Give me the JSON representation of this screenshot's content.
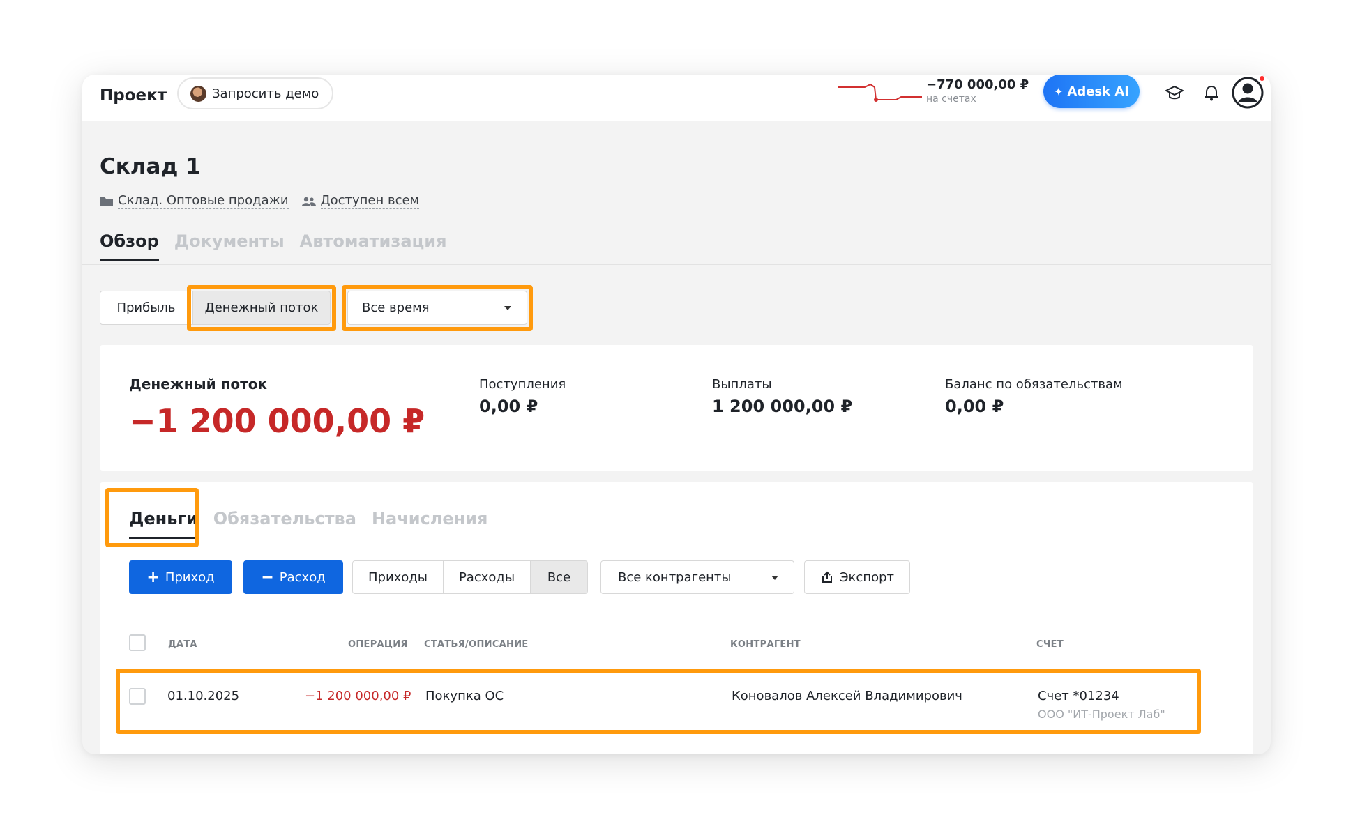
{
  "topbar": {
    "brand": "Проект",
    "demo_button": "Запросить демо",
    "balance_amount": "−770 000,00 ₽",
    "balance_caption": "на счетах",
    "ai_button": "Adesk AI"
  },
  "page": {
    "title": "Склад 1",
    "folder": "Склад. Оптовые продажи",
    "access": "Доступен всем",
    "tabs": [
      {
        "label": "Обзор",
        "active": true
      },
      {
        "label": "Документы",
        "active": false
      },
      {
        "label": "Автоматизация",
        "active": false
      }
    ]
  },
  "controls": {
    "mode_profit": "Прибыль",
    "mode_cashflow": "Денежный поток",
    "period": "Все время"
  },
  "summary": {
    "cashflow_label": "Денежный поток",
    "cashflow_value": "−1 200 000,00 ₽",
    "income_label": "Поступления",
    "income_value": "0,00 ₽",
    "payments_label": "Выплаты",
    "payments_value": "1 200 000,00 ₽",
    "liabilities_label": "Баланс по обязательствам",
    "liabilities_value": "0,00 ₽"
  },
  "money": {
    "tabs": [
      {
        "label": "Деньги",
        "active": true
      },
      {
        "label": "Обязательства",
        "active": false
      },
      {
        "label": "Начисления",
        "active": false
      }
    ],
    "add_income": "Приход",
    "add_expense": "Расход",
    "filter_incomes": "Приходы",
    "filter_expenses": "Расходы",
    "filter_all": "Все",
    "counterparty_select": "Все контрагенты",
    "export": "Экспорт",
    "columns": {
      "date": "ДАТА",
      "operation": "ОПЕРАЦИЯ",
      "category": "СТАТЬЯ/ОПИСАНИЕ",
      "counterparty": "КОНТРАГЕНТ",
      "account": "СЧЕТ"
    },
    "rows": [
      {
        "date": "01.10.2025",
        "amount": "−1 200 000,00 ₽",
        "category": "Покупка ОС",
        "counterparty": "Коновалов Алексей Владимирович",
        "account": "Счет *01234",
        "company": "ООО \"ИТ-Проект Лаб\""
      }
    ]
  },
  "colors": {
    "accent_blue": "#0f66e0",
    "negative_red": "#c62828",
    "highlight_orange": "#ff9a0d"
  }
}
